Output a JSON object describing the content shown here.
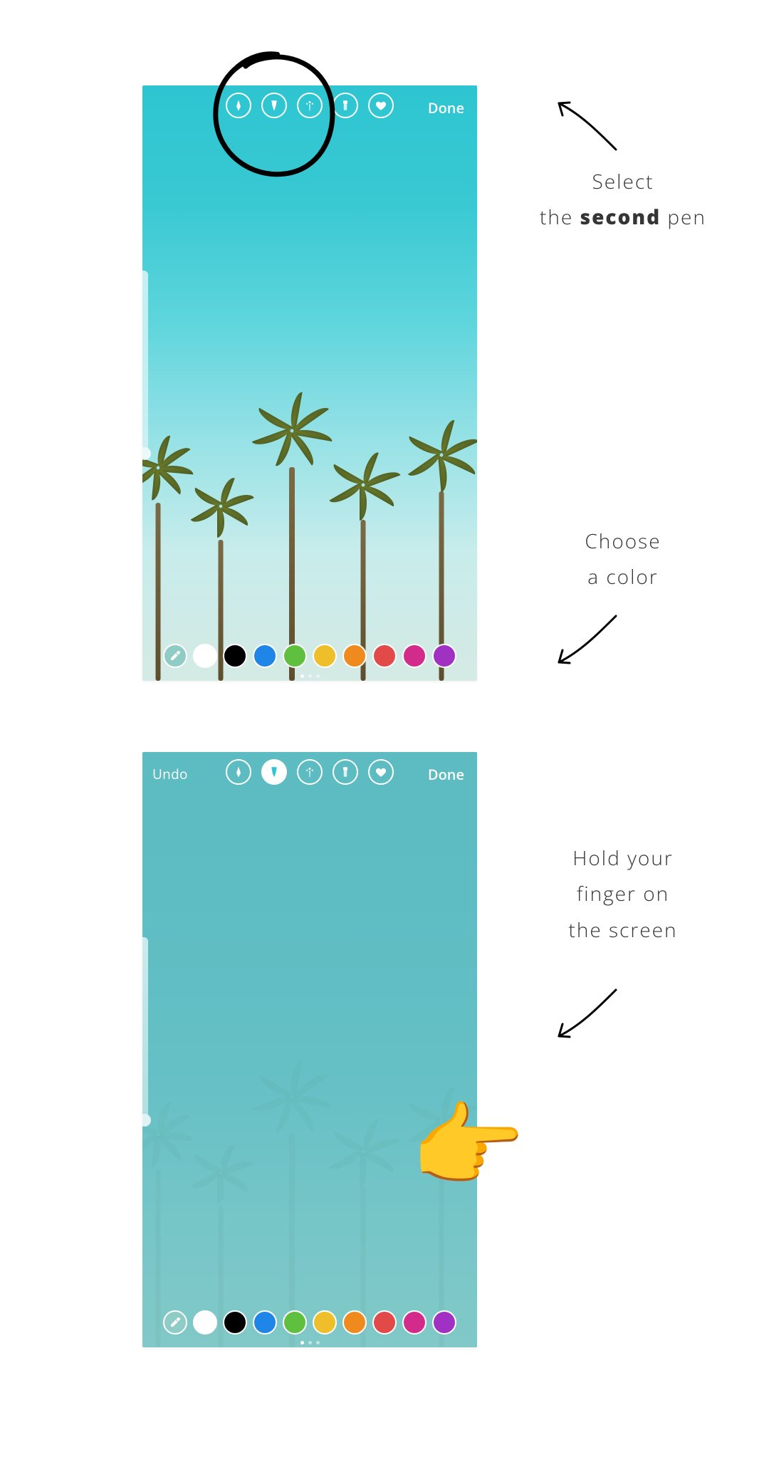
{
  "annotations": {
    "note1_prefix": "Select",
    "note1_line2_pre": "the ",
    "note1_strong": "second",
    "note1_line2_post": " pen",
    "note2_line1": "Choose",
    "note2_line2": "a color",
    "note3_line1": "Hold your",
    "note3_line2": "finger on",
    "note3_line3": "the screen"
  },
  "top_phone": {
    "undo_label": "",
    "done_label": "Done",
    "tools": [
      {
        "name": "pen-sharp-icon",
        "selected": false
      },
      {
        "name": "pen-chisel-icon",
        "selected": false
      },
      {
        "name": "neon-pen-icon",
        "selected": false
      },
      {
        "name": "eraser-icon",
        "selected": false
      },
      {
        "name": "heart-pen-icon",
        "selected": false
      }
    ],
    "palette": [
      {
        "name": "eyedropper",
        "color": "#8fccc5",
        "is_eyedropper": true
      },
      {
        "name": "white",
        "color": "#ffffff"
      },
      {
        "name": "black",
        "color": "#000000"
      },
      {
        "name": "blue",
        "color": "#1f86e8"
      },
      {
        "name": "green",
        "color": "#5fbf3f"
      },
      {
        "name": "yellow",
        "color": "#eebf2b"
      },
      {
        "name": "orange",
        "color": "#ef8b1e"
      },
      {
        "name": "red",
        "color": "#e24a4a"
      },
      {
        "name": "magenta",
        "color": "#d32b8c"
      },
      {
        "name": "purple",
        "color": "#a131c3"
      }
    ]
  },
  "bottom_phone": {
    "undo_label": "Undo",
    "done_label": "Done",
    "tools": [
      {
        "name": "pen-sharp-icon",
        "selected": false
      },
      {
        "name": "pen-chisel-icon",
        "selected": true
      },
      {
        "name": "neon-pen-icon",
        "selected": false
      },
      {
        "name": "eraser-icon",
        "selected": false
      },
      {
        "name": "heart-pen-icon",
        "selected": false
      }
    ],
    "palette": [
      {
        "name": "eyedropper",
        "color": "#8fccc5",
        "is_eyedropper": true
      },
      {
        "name": "white",
        "color": "#ffffff"
      },
      {
        "name": "black",
        "color": "#000000"
      },
      {
        "name": "blue",
        "color": "#1f86e8"
      },
      {
        "name": "green",
        "color": "#5fbf3f"
      },
      {
        "name": "yellow",
        "color": "#eebf2b"
      },
      {
        "name": "orange",
        "color": "#ef8b1e"
      },
      {
        "name": "red",
        "color": "#e24a4a"
      },
      {
        "name": "magenta",
        "color": "#d32b8c"
      },
      {
        "name": "purple",
        "color": "#a131c3"
      }
    ]
  },
  "hand_emoji": "👈"
}
